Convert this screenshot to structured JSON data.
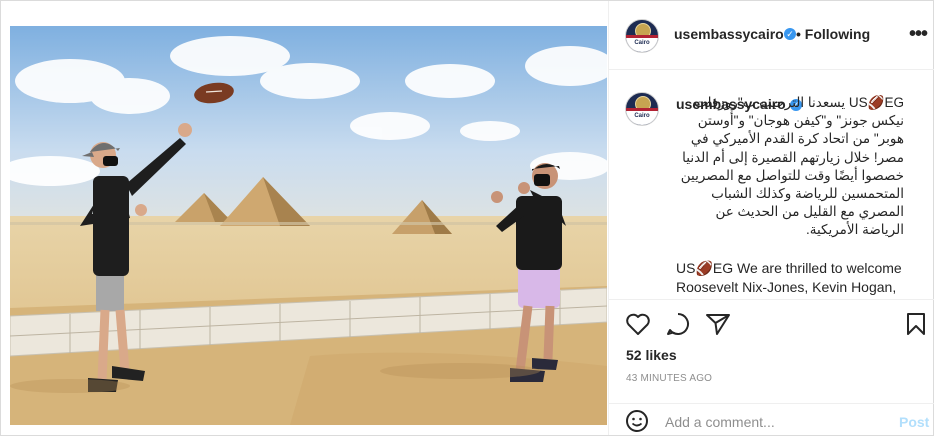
{
  "post": {
    "username": "usembassycairo",
    "verified": true,
    "follow_status": "Following",
    "avatar_text": "Cairo",
    "caption_arabic": "US🏈EG يسعدنا الترحيب ب\"روزفلت نيكس جونز\" و\"كيفن هوجان\" و\"أوستن هوبر\" من اتحاد كرة القدم الأميركي في مصر! خلال زيارتهم القصيرة إلى أم الدنيا خصصوا أيضًا وقت للتواصل مع المصريين المتحمسين للرياضة وكذلك الشباب المصري مع القليل من الحديث عن الرياضة الأمريكية.",
    "caption_english": "US🏈EG We are thrilled to welcome Roosevelt Nix-Jones, Kevin Hogan,",
    "likes": "52 likes",
    "time_ago": "43 MINUTES AGO",
    "comment_placeholder": "Add a comment...",
    "post_label": "Post"
  },
  "icons": {
    "more": "more-options-icon",
    "like": "heart-icon",
    "comment": "comment-icon",
    "share": "paper-plane-icon",
    "save": "bookmark-icon",
    "emoji": "emoji-icon"
  },
  "colors": {
    "verified": "#3897f0",
    "post_disabled": "#b2dffc",
    "meta_gray": "#8e8e8e"
  }
}
